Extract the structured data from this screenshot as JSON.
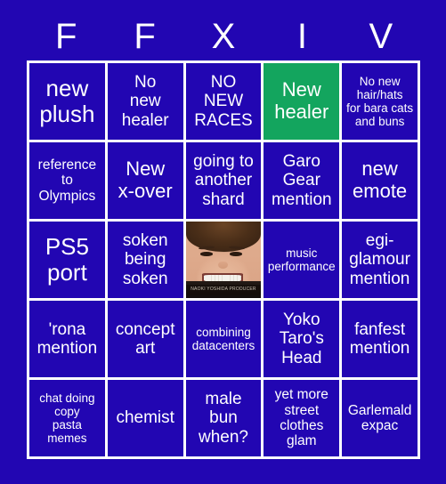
{
  "card": {
    "title_letters": [
      "F",
      "F",
      "X",
      "I",
      "V"
    ],
    "colors": {
      "background": "#2206b2",
      "cell": "#2206b2",
      "grid_line": "#ffffff",
      "text": "#ffffff",
      "marked": "#13a55e"
    },
    "rows": [
      [
        {
          "text": "new\nplush",
          "marked": false,
          "size": "xl"
        },
        {
          "text": "No\nnew\nhealer",
          "marked": false,
          "size": "md"
        },
        {
          "text": "NO\nNEW\nRACES",
          "marked": false,
          "size": "md"
        },
        {
          "text": "New\nhealer",
          "marked": true,
          "size": "lg"
        },
        {
          "text": "No new\nhair/hats\nfor bara cats\nand buns",
          "marked": false,
          "size": "xs"
        }
      ],
      [
        {
          "text": "reference\nto\nOlympics",
          "marked": false,
          "size": "sm"
        },
        {
          "text": "New\nx-over",
          "marked": false,
          "size": "lg"
        },
        {
          "text": "going to\nanother\nshard",
          "marked": false,
          "size": "md"
        },
        {
          "text": "Garo\nGear\nmention",
          "marked": false,
          "size": "md"
        },
        {
          "text": "new\nemote",
          "marked": false,
          "size": "lg"
        }
      ],
      [
        {
          "text": "PS5\nport",
          "marked": false,
          "size": "xl"
        },
        {
          "text": "soken\nbeing\nsoken",
          "marked": false,
          "size": "md"
        },
        {
          "text": "",
          "marked": false,
          "size": "md",
          "free_space": true,
          "photo_caption": "NAOKI YOSHIDA PRODUCER"
        },
        {
          "text": "music\nperformance",
          "marked": false,
          "size": "xs"
        },
        {
          "text": "egi-\nglamour\nmention",
          "marked": false,
          "size": "md"
        }
      ],
      [
        {
          "text": "'rona\nmention",
          "marked": false,
          "size": "md"
        },
        {
          "text": "concept\nart",
          "marked": false,
          "size": "md"
        },
        {
          "text": "combining\ndatacenters",
          "marked": false,
          "size": "xs"
        },
        {
          "text": "Yoko\nTaro's\nHead",
          "marked": false,
          "size": "md"
        },
        {
          "text": "fanfest\nmention",
          "marked": false,
          "size": "md"
        }
      ],
      [
        {
          "text": "chat doing\ncopy\npasta\nmemes",
          "marked": false,
          "size": "xs"
        },
        {
          "text": "chemist",
          "marked": false,
          "size": "md"
        },
        {
          "text": "male\nbun\nwhen?",
          "marked": false,
          "size": "md"
        },
        {
          "text": "yet more\nstreet\nclothes\nglam",
          "marked": false,
          "size": "sm"
        },
        {
          "text": "Garlemald\nexpac",
          "marked": false,
          "size": "sm"
        }
      ]
    ]
  }
}
